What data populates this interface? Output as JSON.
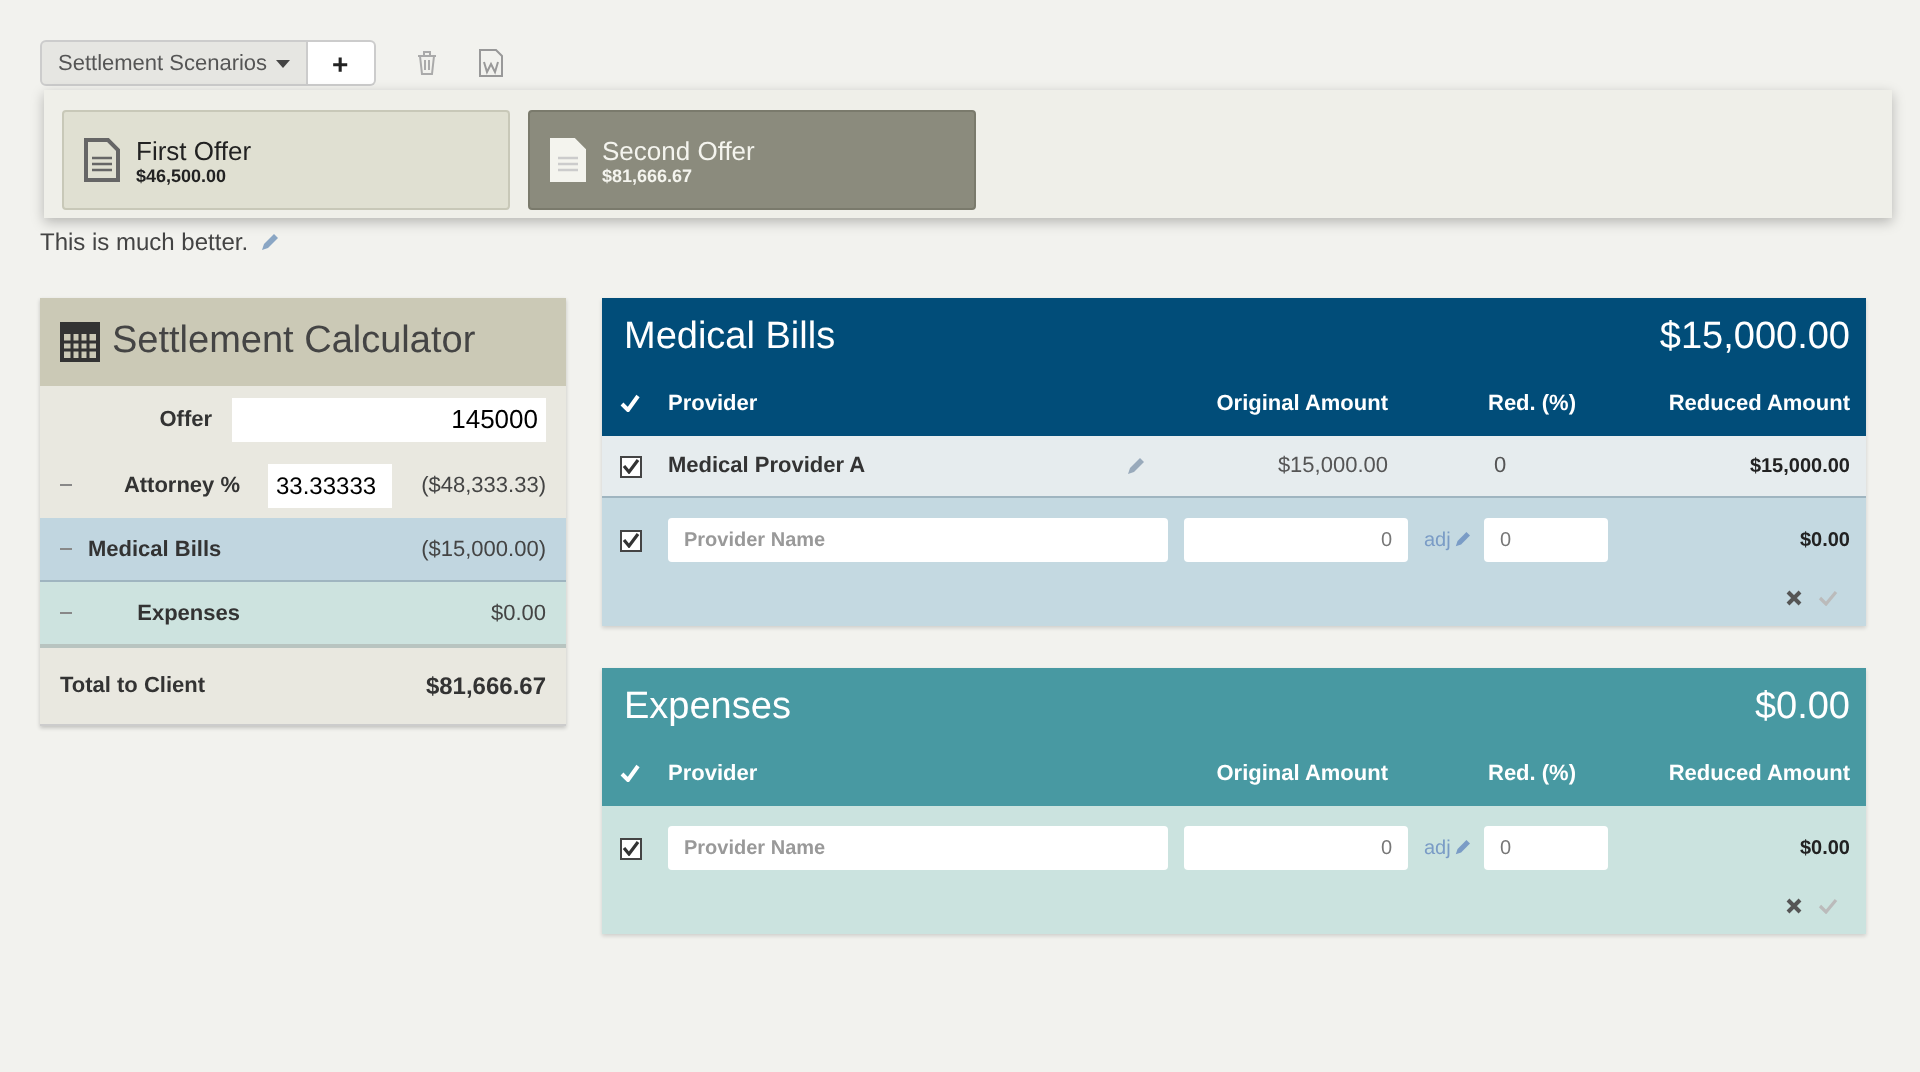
{
  "toolbar": {
    "scenarios_button": "Settlement Scenarios",
    "add_button": "+"
  },
  "scenarios": [
    {
      "name": "First Offer",
      "amount": "$46,500.00",
      "selected": false
    },
    {
      "name": "Second Offer",
      "amount": "$81,666.67",
      "selected": true
    }
  ],
  "note": "This is much better.",
  "calculator": {
    "title": "Settlement Calculator",
    "rows": [
      {
        "kind": "offer",
        "label": "Offer",
        "value": "145000"
      },
      {
        "kind": "attorney",
        "label": "Attorney %",
        "value": "33.33333",
        "amount": "($48,333.33)"
      },
      {
        "kind": "medical",
        "label": "Medical Bills",
        "amount": "($15,000.00)"
      },
      {
        "kind": "expenses",
        "label": "Expenses",
        "amount": "$0.00"
      },
      {
        "kind": "total",
        "label": "Total to Client",
        "amount": "$81,666.67"
      }
    ]
  },
  "panels": [
    {
      "kind": "medical",
      "title": "Medical Bills",
      "total": "$15,000.00",
      "columns": [
        "Provider",
        "Original Amount",
        "Red. (%)",
        "Reduced Amount"
      ],
      "items": [
        {
          "checked": true,
          "provider": "Medical Provider A",
          "original": "$15,000.00",
          "reduction": "0",
          "reduced": "$15,000.00"
        }
      ],
      "new_row": {
        "checked": true,
        "placeholder": "Provider Name",
        "original": "0",
        "adj": "adj",
        "reduction": "0",
        "reduced": "$0.00"
      }
    },
    {
      "kind": "expenses",
      "title": "Expenses",
      "total": "$0.00",
      "columns": [
        "Provider",
        "Original Amount",
        "Red. (%)",
        "Reduced Amount"
      ],
      "new_row": {
        "checked": true,
        "placeholder": "Provider Name",
        "original": "0",
        "adj": "adj",
        "reduction": "0",
        "reduced": "$0.00"
      }
    }
  ]
}
